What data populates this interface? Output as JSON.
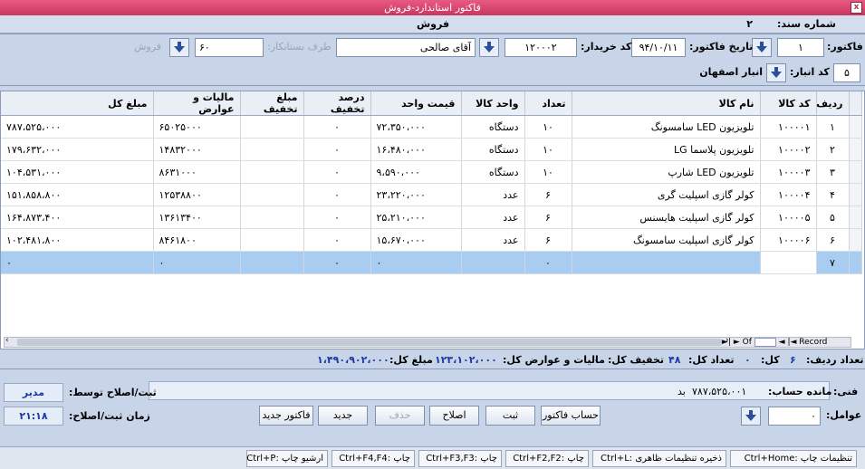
{
  "window": {
    "title": "فاکتور استاندارد-فروش",
    "close": "x"
  },
  "header": {
    "doc_number_label": "شماره سند:",
    "doc_number": "۲",
    "doc_type": "فروش"
  },
  "form": {
    "invoice_label": "فاکتور:",
    "invoice_value": "۱",
    "invoice_date_label": "تاریخ فاکتور:",
    "invoice_date": "۹۴/۱۰/۱۱",
    "buyer_code_label": "کد خریدار:",
    "buyer_code": "۱۲۰۰۰۲",
    "buyer_name": "آقای صالحی",
    "creditor_label": "طرف بستانکار:",
    "creditor_value": "۶۰",
    "type_label": "فروش",
    "warehouse_code_label": "کد انبار:",
    "warehouse_code": "۵",
    "warehouse_name": "انبار اصفهان"
  },
  "grid": {
    "columns": [
      "ردیف",
      "کد کالا",
      "نام کالا",
      "تعداد",
      "واحد کالا",
      "قیمت واحد",
      "درصد تخفیف",
      "مبلغ تخفیف",
      "مالیات و عوارض",
      "مبلغ کل"
    ],
    "rows": [
      [
        "۱",
        "۱۰۰۰۰۱",
        "تلویزیون LED سامسونگ",
        "۱۰",
        "دستگاه",
        "۷۲،۳۵۰،۰۰۰",
        "۰",
        "",
        "۶۵۰۲۵۰۰۰",
        "۷۸۷،۵۲۵،۰۰۰"
      ],
      [
        "۲",
        "۱۰۰۰۰۲",
        "تلویزیون پلاسما LG",
        "۱۰",
        "دستگاه",
        "۱۶،۴۸۰،۰۰۰",
        "۰",
        "",
        "۱۴۸۳۲۰۰۰",
        "۱۷۹،۶۳۲،۰۰۰"
      ],
      [
        "۳",
        "۱۰۰۰۰۳",
        "تلویزیون LED شارپ",
        "۱۰",
        "دستگاه",
        "۹،۵۹۰،۰۰۰",
        "۰",
        "",
        "۸۶۳۱۰۰۰",
        "۱۰۴،۵۳۱،۰۰۰"
      ],
      [
        "۴",
        "۱۰۰۰۰۴",
        "کولر گازی اسپلیت گری",
        "۶",
        "عدد",
        "۲۳،۲۲۰،۰۰۰",
        "۰",
        "",
        "۱۲۵۳۸۸۰۰",
        "۱۵۱،۸۵۸،۸۰۰"
      ],
      [
        "۵",
        "۱۰۰۰۰۵",
        "کولر گازی اسپلیت هایسنس",
        "۶",
        "عدد",
        "۲۵،۲۱۰،۰۰۰",
        "۰",
        "",
        "۱۳۶۱۳۴۰۰",
        "۱۶۴،۸۷۳،۴۰۰"
      ],
      [
        "۶",
        "۱۰۰۰۰۶",
        "کولر گازی اسپلیت سامسونگ",
        "۶",
        "عدد",
        "۱۵،۶۷۰،۰۰۰",
        "۰",
        "",
        "۸۴۶۱۸۰۰",
        "۱۰۲،۴۸۱،۸۰۰"
      ]
    ],
    "new_row": [
      "۷",
      "",
      "",
      "۰",
      "",
      "۰",
      "۰",
      "",
      "۰",
      "۰"
    ],
    "nav": {
      "record_label": "Record",
      "of_label": "Of",
      "prev_all": "|◄",
      "prev": "◄",
      "next": "►",
      "next_all": "►|"
    }
  },
  "totals": {
    "rows_label": "تعداد ردیف:",
    "rows_value": "۶",
    "count_label": "کل:",
    "count_value": "۰",
    "qty_label": "تعداد کل:",
    "qty_value": "۴۸",
    "discount_label": "تخفیف کل:",
    "discount_value": "۰",
    "tax_label": "مالیات و عوارض کل:",
    "tax_value": "۱۲۳،۱۰۲،۰۰۰",
    "sum_label": "مبلغ کل:",
    "sum_value": "۱،۴۹۰،۹۰۲،۰۰۰"
  },
  "lower": {
    "tech_label": "فنی:",
    "balance_label": "مانده حساب:",
    "balance_value": "۷۸۷،۵۲۵،۰۰۱",
    "balance_type": "بد",
    "factors_label": "عوامل:",
    "factors_value": "۰",
    "registered_by_label": "ثبت/اصلاح توسط:",
    "registered_by": "مدیر",
    "reg_time_label": "زمان ثبت/اصلاح:",
    "reg_time": "۲۱:۱۸",
    "buttons": {
      "invoice_account": "حساب فاکتور",
      "register": "ثبت",
      "edit": "اصلاح",
      "delete": "حذف",
      "new": "جدید",
      "new_invoice": "فاکتور جدید"
    }
  },
  "statusbar": {
    "print_settings": "تنظیمات چاپ :Ctrl+Home",
    "save_appearance": "ذخیره تنظیمات ظاهری :Ctrl+L",
    "print_f2": "چاپ :Ctrl+F2,F2",
    "print_f3": "چاپ :Ctrl+F3,F3",
    "print_f4": "چاپ :Ctrl+F4,F4",
    "archive_print": "ارشیو چاپ :Ctrl+P"
  }
}
